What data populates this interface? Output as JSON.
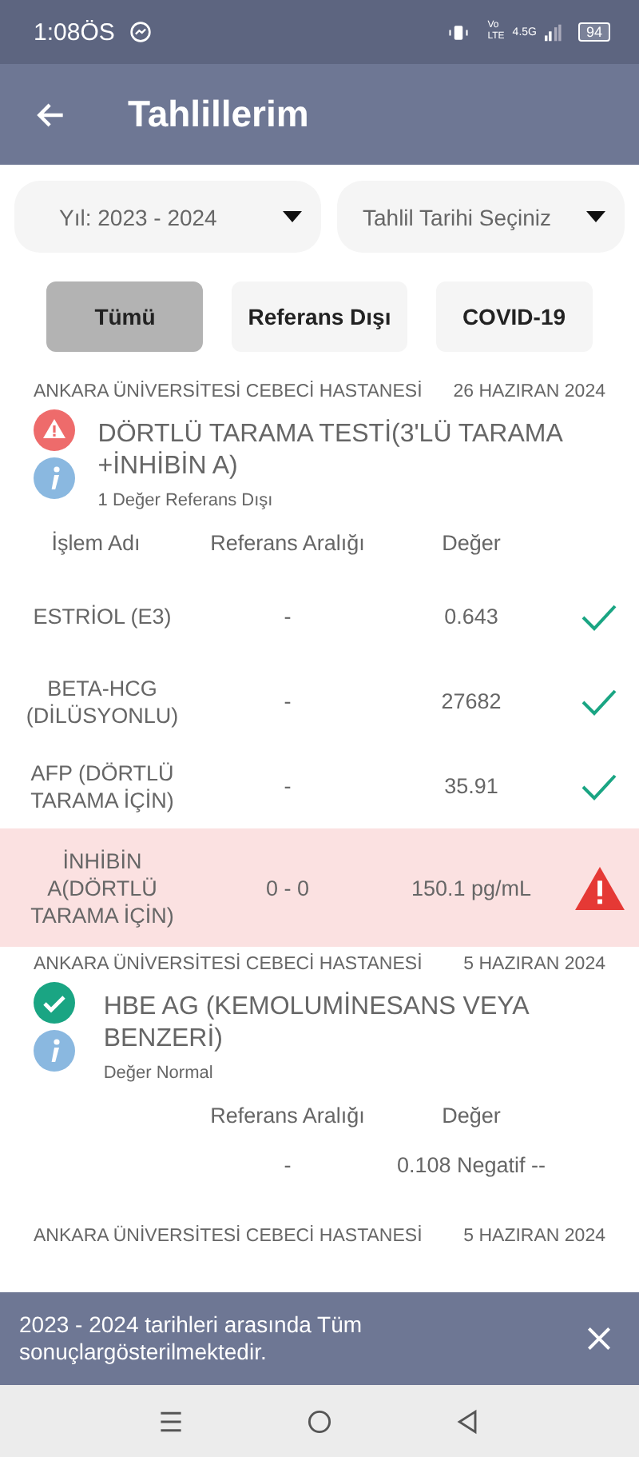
{
  "status_bar": {
    "time": "1:08ÖS",
    "network_top": "Vo",
    "network_bottom": "LTE",
    "network_type": "4.5G",
    "battery": "94"
  },
  "app_bar": {
    "title": "Tahlillerim"
  },
  "filters": [
    {
      "label": "Yıl: 2023 - 2024"
    },
    {
      "label": "Tahlil Tarihi Seçiniz"
    }
  ],
  "chips": [
    {
      "label": "Tümü",
      "selected": true
    },
    {
      "label": "Referans Dışı",
      "selected": false
    },
    {
      "label": "COVID-19",
      "selected": false
    }
  ],
  "results": [
    {
      "hospital": "ANKARA ÜNİVERSİTESİ CEBECİ HASTANESİ",
      "date": "26 HAZIRAN 2024",
      "kind": "alert",
      "title": "DÖRTLÜ TARAMA TESTİ(3'LÜ TARAMA +İNHİBİN A)",
      "summary": "1 Değer Referans Dışı",
      "headers": {
        "name": "İşlem Adı",
        "range": "Referans Aralığı",
        "value": "Değer"
      },
      "rows": [
        {
          "name": "ESTRİOL (E3)",
          "range": "-",
          "value": "0.643",
          "out_of_range": false
        },
        {
          "name": "BETA-HCG (DİLÜSYONLU)",
          "range": "-",
          "value": "27682",
          "out_of_range": false
        },
        {
          "name": "AFP (DÖRTLÜ TARAMA İÇİN)",
          "range": "-",
          "value": "35.91",
          "out_of_range": false
        },
        {
          "name": "İNHİBİN A(DÖRTLÜ TARAMA İÇİN)",
          "range": "0 - 0",
          "value": "150.1 pg/mL",
          "out_of_range": true
        }
      ]
    },
    {
      "hospital": "ANKARA ÜNİVERSİTESİ CEBECİ HASTANESİ",
      "date": "5 HAZIRAN 2024",
      "kind": "normal",
      "title": "HBE AG (KEMOLUMİNESANS VEYA BENZERİ)",
      "summary": "Değer Normal",
      "headers": {
        "range": "Referans Aralığı",
        "value": "Değer"
      },
      "rows": [
        {
          "range": "-",
          "value": "0.108 Negatif --"
        }
      ]
    },
    {
      "hospital": "ANKARA ÜNİVERSİTESİ CEBECİ HASTANESİ",
      "date": "5 HAZIRAN 2024"
    }
  ],
  "snackbar": {
    "message": "2023 - 2024 tarihleri arasında Tüm sonuçlargösterilmektedir."
  }
}
